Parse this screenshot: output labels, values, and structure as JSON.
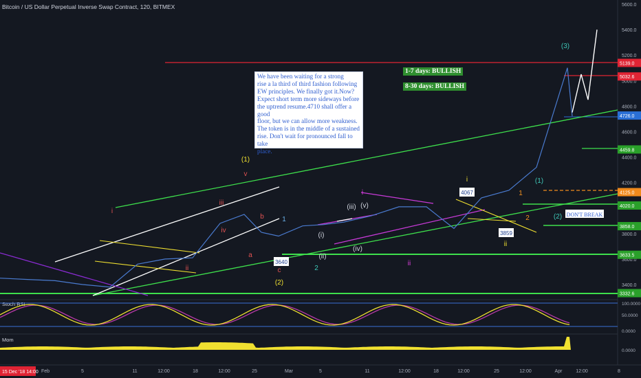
{
  "header": {
    "title": "Bitcoin / US Dollar Perpetual Inverse Swap Contract, 120, BITMEX"
  },
  "annotation": {
    "text": "We have been waiting for a strong\nrise a la third of third fashion following\nEW principles. We finally got it.Now?\nExpect short term more sideways before\nthe uptrend resume.4710 shall offer a good\nfloor, but we can allow more weakness.\nThe token is in the middle of a sustained\nrise. Don't wait for pronounced fall to take\nplace.",
    "short_term": "1-7 days: BULLISH",
    "long_term": "8-30 days: BULLISH",
    "dont_break": "DON'T BREAK"
  },
  "colors": {
    "background": "#141821",
    "price_line": "#4a7bd0",
    "green_line": "#3ee04c",
    "red_line": "#e02434",
    "white_line": "#ffffff",
    "yellow_line": "#f0e030",
    "magenta_line": "#c83ad8",
    "purple_line": "#8a2bd2",
    "rsi_k": "#f0e030",
    "rsi_d": "#b83aa8",
    "mom_fill": "#f0e030"
  },
  "price_axis_ticks": [
    "5600.0",
    "5400.0",
    "5200.0",
    "5000.0",
    "4800.0",
    "4600.0",
    "4400.0",
    "4200.0",
    "3800.0",
    "3600.0",
    "3400.0"
  ],
  "price_labels": [
    {
      "text": "5139.0",
      "color": "#e02434",
      "value": 5139
    },
    {
      "text": "5032.6",
      "color": "#e02434",
      "value": 5032.6
    },
    {
      "text": "4726.0",
      "color": "#2a6fd6",
      "value": 4726
    },
    {
      "text": "4459.8",
      "color": "#2aa02a",
      "value": 4459.8
    },
    {
      "text": "4125.0",
      "color": "#f08a1c",
      "value": 4125
    },
    {
      "text": "4020.0",
      "color": "#2aa02a",
      "value": 4020
    },
    {
      "text": "3858.0",
      "color": "#2aa02a",
      "value": 3858
    },
    {
      "text": "3633.5",
      "color": "#2aa02a",
      "value": 3633.5
    },
    {
      "text": "3332.6",
      "color": "#2aa02a",
      "value": 3332.6
    }
  ],
  "wave_labels": [
    {
      "text": "(1)",
      "color": "#f0e030"
    },
    {
      "text": "v",
      "color": "#e05252"
    },
    {
      "text": "iii",
      "color": "#e05252"
    },
    {
      "text": "iv",
      "color": "#e05252"
    },
    {
      "text": "i",
      "color": "#e05252"
    },
    {
      "text": "ii",
      "color": "#e05252"
    },
    {
      "text": "b",
      "color": "#e05252"
    },
    {
      "text": "1",
      "color": "#6ab0e8"
    },
    {
      "text": "a",
      "color": "#e05252"
    },
    {
      "text": "c",
      "color": "#e05252"
    },
    {
      "text": "(2)",
      "color": "#f0e030"
    },
    {
      "text": "2",
      "color": "#3ec8b8"
    },
    {
      "text": "(i)",
      "color": "#d0d4de"
    },
    {
      "text": "(ii)",
      "color": "#d0d4de"
    },
    {
      "text": "(iii)",
      "color": "#d0d4de"
    },
    {
      "text": "(iv)",
      "color": "#d0d4de"
    },
    {
      "text": "(v)",
      "color": "#d0d4de"
    },
    {
      "text": "i",
      "color": "#e040e0"
    },
    {
      "text": "ii",
      "color": "#e040e0"
    },
    {
      "text": "i",
      "color": "#f0e030"
    },
    {
      "text": "ii",
      "color": "#f0e030"
    },
    {
      "text": "1",
      "color": "#f09020"
    },
    {
      "text": "2",
      "color": "#f09020"
    },
    {
      "text": "(1)",
      "color": "#3ec8b8"
    },
    {
      "text": "(2)",
      "color": "#3ec8b8"
    },
    {
      "text": "(3)",
      "color": "#3ec8b8"
    }
  ],
  "price_callouts": [
    "3640",
    "4067",
    "3859"
  ],
  "stoch_rsi": {
    "label": "Stoch RSI",
    "ticks": [
      "100.0000",
      "50.0000",
      "0.0000"
    ]
  },
  "momentum": {
    "label": "Mom",
    "ticks": [
      "0.0000"
    ]
  },
  "time_axis": {
    "ticks": [
      "Feb",
      "5",
      "11",
      "12:00",
      "18",
      "12:00",
      "25",
      "Mar",
      "5",
      "11",
      "12:00",
      "18",
      "12:00",
      "25",
      "12:00",
      "Apr",
      "12:00",
      "8"
    ],
    "cursor_label": "15 Dec '18  14:00"
  },
  "chart_data": {
    "type": "line",
    "title": "Bitcoin / US Dollar Perpetual Inverse Swap Contract, 120, BITMEX",
    "x": [
      "Jan 28",
      "Feb 1",
      "Feb 5",
      "Feb 8",
      "Feb 11",
      "Feb 15",
      "Feb 18",
      "Feb 21",
      "Feb 24",
      "Feb 27",
      "Mar 1",
      "Mar 5",
      "Mar 8",
      "Mar 11",
      "Mar 15",
      "Mar 18",
      "Mar 21",
      "Mar 24",
      "Mar 27",
      "Mar 30",
      "Apr 1",
      "Apr 2",
      "Apr 3",
      "Apr 4"
    ],
    "series": [
      {
        "values": [
          3450,
          3440,
          3430,
          3400,
          3380,
          3560,
          3600,
          3610,
          3880,
          3950,
          3810,
          3780,
          3860,
          3870,
          3890,
          3940,
          4010,
          4010,
          3840,
          4080,
          4140,
          4320,
          5100,
          4720
        ]
      }
    ],
    "projection": {
      "x": [
        "Apr 4",
        "Apr 5",
        "Apr 6",
        "Apr 7"
      ],
      "values": [
        4750,
        5050,
        4850,
        5400
      ]
    },
    "ylim": [
      3300,
      5700
    ]
  }
}
